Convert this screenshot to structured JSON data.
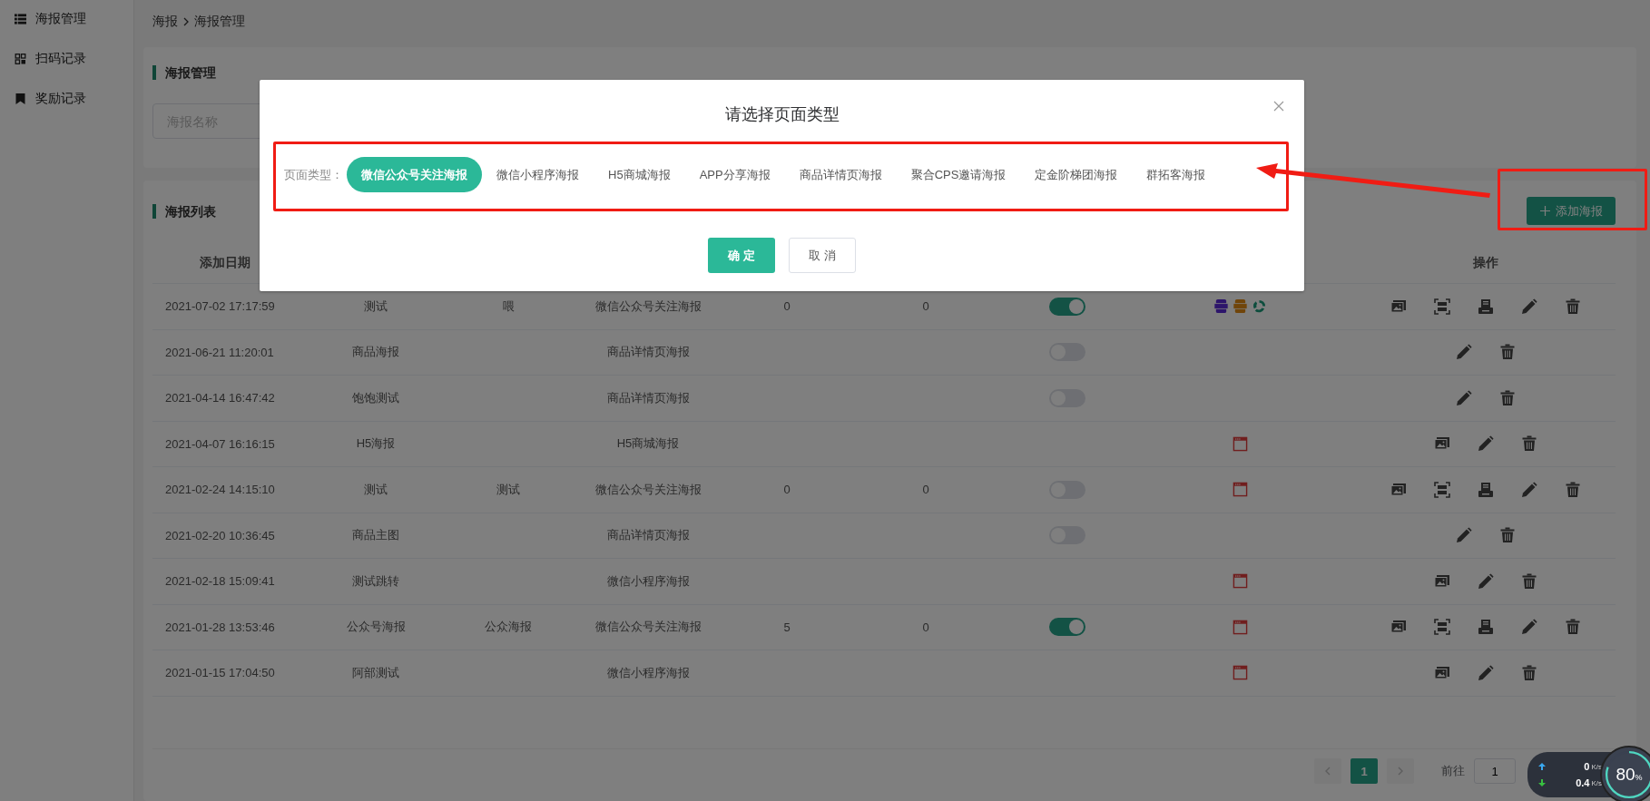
{
  "sidebar": {
    "items": [
      {
        "label": "海报管理"
      },
      {
        "label": "扫码记录"
      },
      {
        "label": "奖励记录"
      }
    ]
  },
  "breadcrumb": [
    "海报",
    "海报管理"
  ],
  "filter_card": {
    "title": "海报管理",
    "search": {
      "placeholder": "海报名称"
    }
  },
  "list_card": {
    "title": "海报列表",
    "add_button": "添加海报",
    "table": {
      "columns": [
        "添加日期",
        "操作"
      ],
      "rows": [
        {
          "date": "2021-07-02 17:17:59",
          "name": "测试",
          "column_3": "喂",
          "type": "微信公众号关注海报",
          "column_5": "0",
          "column_6": "0",
          "switch": {
            "on": true
          },
          "badges": [
            {
              "kind": "wap"
            },
            {
              "kind": "app"
            },
            {
              "kind": "share"
            }
          ],
          "actions": [
            {
              "kind": "image"
            },
            {
              "kind": "scan"
            },
            {
              "kind": "print"
            },
            {
              "kind": "edit"
            },
            {
              "kind": "delete"
            }
          ]
        },
        {
          "date": "2021-06-21 11:20:01",
          "name": "商品海报",
          "type": "商品详情页海报",
          "switch": {
            "on": false
          },
          "actions": [
            {
              "kind": "edit"
            },
            {
              "kind": "delete"
            }
          ]
        },
        {
          "date": "2021-04-14 16:47:42",
          "name": "饱饱测试",
          "type": "商品详情页海报",
          "switch": {
            "on": false
          },
          "actions": [
            {
              "kind": "edit"
            },
            {
              "kind": "delete"
            }
          ]
        },
        {
          "date": "2021-04-07 16:16:15",
          "name": "H5海报",
          "type": "H5商城海报",
          "badges": [
            {
              "kind": "page"
            }
          ],
          "actions": [
            {
              "kind": "image"
            },
            {
              "kind": "edit"
            },
            {
              "kind": "delete"
            }
          ]
        },
        {
          "date": "2021-02-24 14:15:10",
          "name": "测试",
          "column_3": "测试",
          "type": "微信公众号关注海报",
          "column_5": "0",
          "column_6": "0",
          "switch": {
            "on": false
          },
          "badges": [
            {
              "kind": "page"
            }
          ],
          "actions": [
            {
              "kind": "image"
            },
            {
              "kind": "scan"
            },
            {
              "kind": "print"
            },
            {
              "kind": "edit"
            },
            {
              "kind": "delete"
            }
          ]
        },
        {
          "date": "2021-02-20 10:36:45",
          "name": "商品主图",
          "type": "商品详情页海报",
          "switch": {
            "on": false
          },
          "actions": [
            {
              "kind": "edit"
            },
            {
              "kind": "delete"
            }
          ]
        },
        {
          "date": "2021-02-18 15:09:41",
          "name": "测试跳转",
          "type": "微信小程序海报",
          "badges": [
            {
              "kind": "page"
            }
          ],
          "actions": [
            {
              "kind": "image"
            },
            {
              "kind": "edit"
            },
            {
              "kind": "delete"
            }
          ]
        },
        {
          "date": "2021-01-28 13:53:46",
          "name": "公众号海报",
          "column_3": "公众海报",
          "type": "微信公众号关注海报",
          "column_5": "5",
          "column_6": "0",
          "switch": {
            "on": true
          },
          "badges": [
            {
              "kind": "page"
            }
          ],
          "actions": [
            {
              "kind": "image"
            },
            {
              "kind": "scan"
            },
            {
              "kind": "print"
            },
            {
              "kind": "edit"
            },
            {
              "kind": "delete"
            }
          ]
        },
        {
          "date": "2021-01-15 17:04:50",
          "name": "阿部测试",
          "type": "微信小程序海报",
          "badges": [
            {
              "kind": "page"
            }
          ],
          "actions": [
            {
              "kind": "image"
            },
            {
              "kind": "edit"
            },
            {
              "kind": "delete"
            }
          ]
        }
      ]
    },
    "pagination": {
      "pages": [
        {
          "label": "1",
          "selected": true
        }
      ],
      "goto_label": "前往",
      "goto_value": "1"
    }
  },
  "dialog": {
    "title": "请选择页面类型",
    "field_label": "页面类型：",
    "options": [
      {
        "label": "微信公众号关注海报",
        "selected": true
      },
      {
        "label": "微信小程序海报",
        "selected": false
      },
      {
        "label": "H5商城海报",
        "selected": false
      },
      {
        "label": "APP分享海报",
        "selected": false
      },
      {
        "label": "商品详情页海报",
        "selected": false
      },
      {
        "label": "聚合CPS邀请海报",
        "selected": false
      },
      {
        "label": "定金阶梯团海报",
        "selected": false
      },
      {
        "label": "群拓客海报",
        "selected": false
      }
    ],
    "buttons": [
      {
        "label": "确 定",
        "kind": "primary"
      },
      {
        "label": "取 消",
        "kind": "default"
      }
    ]
  },
  "network_widget": {
    "upload": "0",
    "upload_unit": "K/s",
    "download": "0.4",
    "download_unit": "K/s",
    "usage": "80",
    "usage_unit": "%",
    "level": 0.8
  }
}
